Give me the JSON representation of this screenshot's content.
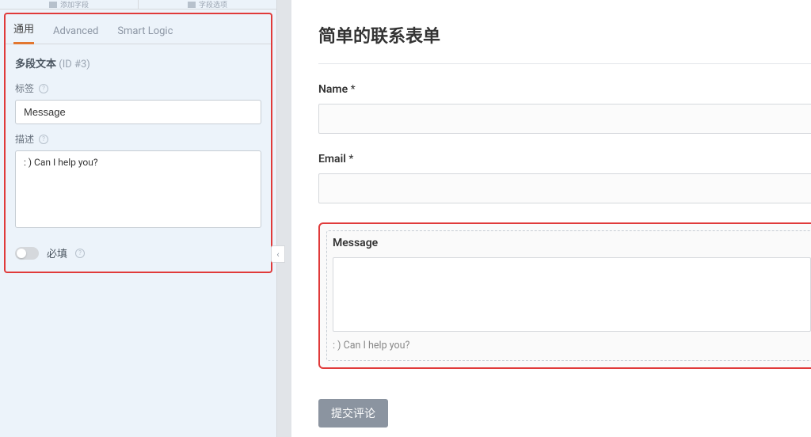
{
  "topTabs": {
    "add": "添加字段",
    "options": "字段选项"
  },
  "subTabs": {
    "general": "通用",
    "advanced": "Advanced",
    "smart": "Smart Logic"
  },
  "section": {
    "title": "多段文本",
    "id": "(ID #3)"
  },
  "labels": {
    "label": "标签",
    "description": "描述",
    "required": "必填"
  },
  "inputs": {
    "labelValue": "Message",
    "descriptionValue": ": ) Can I help you?"
  },
  "collapseGlyph": "‹",
  "preview": {
    "formTitle": "简单的联系表单",
    "name": {
      "label": "Name",
      "star": "*"
    },
    "email": {
      "label": "Email",
      "star": "*"
    },
    "message": {
      "label": "Message",
      "help": ": ) Can I help you?"
    },
    "submit": "提交评论"
  }
}
